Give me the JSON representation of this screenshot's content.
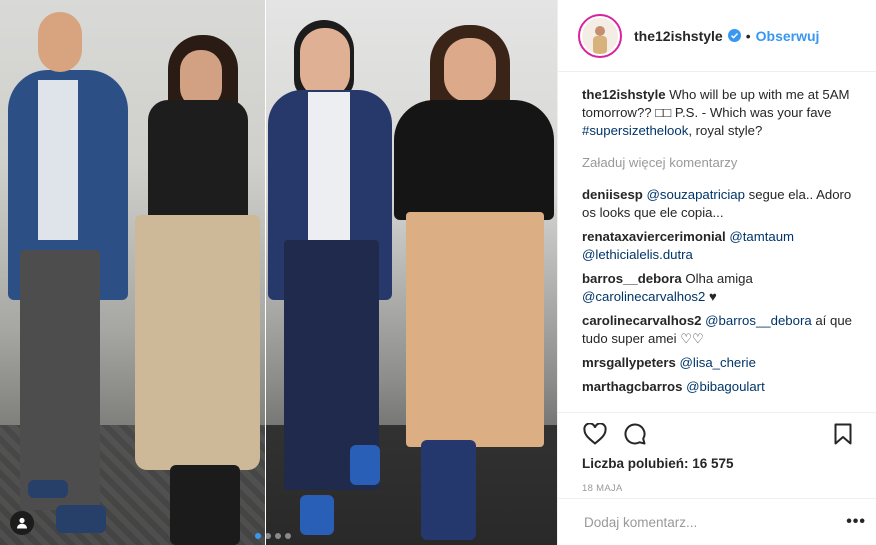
{
  "header": {
    "username": "the12ishstyle",
    "separator": "•",
    "follow_label": "Obserwuj"
  },
  "caption": {
    "username": "the12ishstyle",
    "text_1": "Who will be up with me at 5AM",
    "text_2": "tomorrow?? □□ P.S. - Which was your fave",
    "hashtag": "#supersizethelook",
    "text_3": ", royal style?"
  },
  "load_more": "Załaduj więcej komentarzy",
  "comments": [
    {
      "user": "deniisesp",
      "mention": "@souzapatriciap",
      "text": "segue ela.. Adoro os looks que ele copia..."
    },
    {
      "user": "renataxaviercerimonial",
      "mention": "@tamtaum",
      "mention2": "@lethicialelis.dutra",
      "text": ""
    },
    {
      "user": "barros__debora",
      "text": "Olha amiga",
      "mention": "@carolinecarvalhos2",
      "text2": "♥"
    },
    {
      "user": "carolinecarvalhos2",
      "mention": "@barros__debora",
      "text": "aí que tudo super amei ♡♡"
    },
    {
      "user": "mrsgallypeters",
      "mention": "@lisa_cherie",
      "text": ""
    },
    {
      "user": "marthagcbarros",
      "mention": "@bibagoulart",
      "text": ""
    }
  ],
  "likes": {
    "label": "Liczba polubień:",
    "count": "16 575"
  },
  "date": "18 MAJA",
  "add_comment": {
    "placeholder": "Dodaj komentarz..."
  },
  "more_label": "•••",
  "colors": {
    "link": "#3897f0",
    "tag": "#003569",
    "muted": "#999999"
  },
  "icons": [
    "heart-icon",
    "comment-icon",
    "bookmark-icon",
    "user-tag-icon",
    "verified-badge-icon"
  ]
}
